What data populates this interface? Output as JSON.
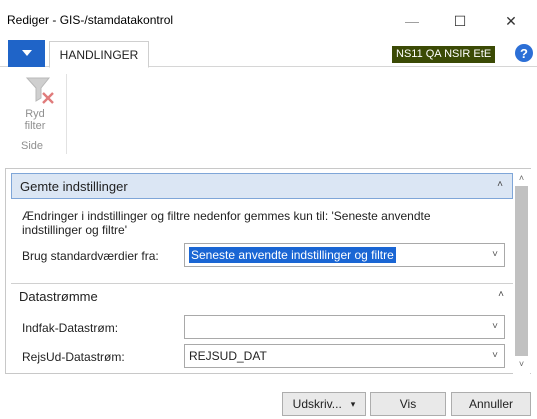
{
  "window": {
    "title": "Rediger - GIS-/stamdatakontrol",
    "controls": {
      "minimize": "—",
      "maximize": "☐",
      "close": "✕"
    }
  },
  "ribbon": {
    "menu_icon": "caret-down-icon",
    "tab": "HANDLINGER",
    "company": "NS11 QA NSIR EtE",
    "help": "?",
    "actions": [
      {
        "label_line1": "Ryd",
        "label_line2": "filter",
        "icon": "clear-filter-icon"
      }
    ],
    "group_label": "Side"
  },
  "sections": {
    "saved_settings": {
      "title": "Gemte indstillinger",
      "info": "Ændringer i indstillinger og filtre nedenfor gemmes kun til: 'Seneste anvendte indstillinger og filtre'",
      "default_label": "Brug standardværdier fra:",
      "default_value": "Seneste anvendte indstillinger og filtre"
    },
    "datastreams": {
      "title": "Datastrømme",
      "fields": [
        {
          "label": "Indfak-Datastrøm:",
          "value": ""
        },
        {
          "label": "RejsUd-Datastrøm:",
          "value": "REJSUD_DAT"
        }
      ]
    }
  },
  "footer": {
    "print_label": "Udskriv...",
    "print_arrow": "▾",
    "view_label": "Vis",
    "cancel_label": "Annuller"
  },
  "colors": {
    "accent": "#1f64c8",
    "company_badge": "#3b4a05",
    "section_header_bg": "#dbe6f4",
    "selection": "#1a66d4"
  }
}
